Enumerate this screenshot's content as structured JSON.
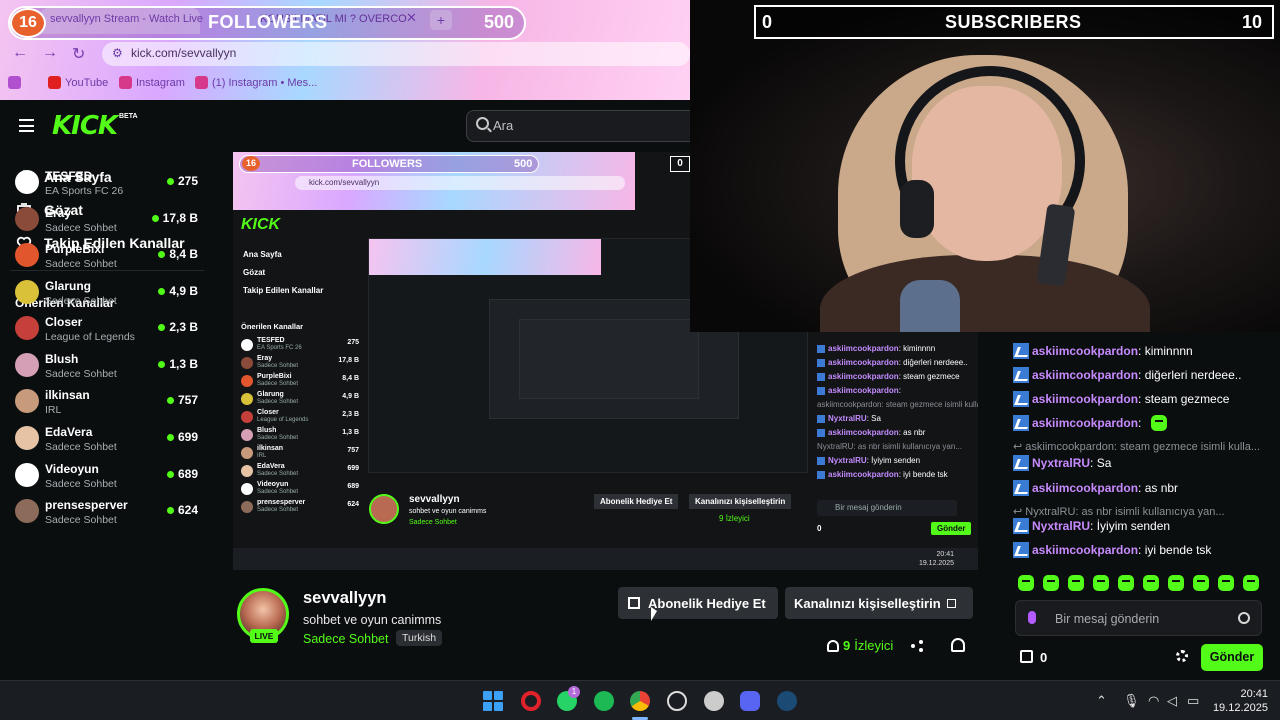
{
  "overlay": {
    "followers": {
      "current": "16",
      "label": "FOLLOWERS",
      "goal": "500"
    },
    "subscribers": {
      "current": "0",
      "label": "SUBSCRIBERS",
      "goal": "10"
    }
  },
  "browser": {
    "tab_active": "sevvallyyn Stream - Watch Live",
    "tab_second": "KONSILMATIL MI ? OVERCO",
    "tab_close": "✕",
    "tab_new": "+",
    "url": "kick.com/sevvallyyn",
    "bookmarks": [
      "YouTube",
      "Instagram",
      "(1) Instagram • Mes..."
    ]
  },
  "header": {
    "logo": "KICK",
    "beta": "BETA",
    "search_placeholder": "Ara"
  },
  "sidebar": {
    "nav": [
      {
        "label": "Ana Sayfa",
        "icon": "home-icon"
      },
      {
        "label": "Gözat",
        "icon": "browse-icon"
      },
      {
        "label": "Takip Edilen Kanallar",
        "icon": "heart-icon"
      }
    ],
    "recommended_title": "Önerilen Kanallar",
    "channels": [
      {
        "name": "TESFED",
        "category": "EA Sports FC 26",
        "viewers": "275",
        "color": "#ffffff"
      },
      {
        "name": "Eray",
        "category": "Sadece Sohbet",
        "viewers": "17,8 B",
        "color": "#8a4b3a"
      },
      {
        "name": "PurpleBixi",
        "category": "Sadece Sohbet",
        "viewers": "8,4 B",
        "color": "#e2562d"
      },
      {
        "name": "Glarung",
        "category": "Sadece Sohbet",
        "viewers": "4,9 B",
        "color": "#d9c23a"
      },
      {
        "name": "Closer",
        "category": "League of Legends",
        "viewers": "2,3 B",
        "color": "#c5403a"
      },
      {
        "name": "Blush",
        "category": "Sadece Sohbet",
        "viewers": "1,3 B",
        "color": "#d5a0b6"
      },
      {
        "name": "ilkinsan",
        "category": "IRL",
        "viewers": "757",
        "color": "#c79a7c"
      },
      {
        "name": "EdaVera",
        "category": "Sadece Sohbet",
        "viewers": "699",
        "color": "#e6c3a5"
      },
      {
        "name": "Videoyun",
        "category": "Sadece Sohbet",
        "viewers": "689",
        "color": "#ffffff"
      },
      {
        "name": "prensesperver",
        "category": "Sadece Sohbet",
        "viewers": "624",
        "color": "#8d6b5a"
      }
    ]
  },
  "preview": {
    "nested_rows": [
      "TESFED",
      "Eray",
      "PurpleBixi",
      "Glarung",
      "Closer",
      "Blush",
      "ilkinsan",
      "EdaVera",
      "Videoyun",
      "prensesperver"
    ],
    "nested_counts": [
      "275",
      "17,8 B",
      "8,4 B",
      "4,9 B",
      "2,3 B",
      "1,3 B",
      "757",
      "699",
      "689",
      "624"
    ],
    "nested_zero": "0"
  },
  "chat": {
    "messages": [
      {
        "type": "msg",
        "user": "askiimcookpardon",
        "text": "kiminnnn"
      },
      {
        "type": "msg",
        "user": "askiimcookpardon",
        "text": "diğerleri nerdeee.."
      },
      {
        "type": "msg",
        "user": "askiimcookpardon",
        "text": "steam gezmece"
      },
      {
        "type": "msg",
        "user": "askiimcookpardon",
        "text": ""
      },
      {
        "type": "reply",
        "text": "askiimcookpardon: steam gezmece isimli kulla..."
      },
      {
        "type": "msg",
        "user": "NyxtralRU",
        "text": "Sa"
      },
      {
        "type": "msg",
        "user": "askiimcookpardon",
        "text": "as nbr"
      },
      {
        "type": "reply",
        "text": "NyxtralRU: as nbr isimli kullanıcıya yan..."
      },
      {
        "type": "msg",
        "user": "NyxtralRU",
        "text": "İyiyim senden"
      },
      {
        "type": "msg",
        "user": "askiimcookpardon",
        "text": "iyi bende tsk"
      }
    ],
    "input_placeholder": "Bir mesaj gönderin",
    "points": "0",
    "send_label": "Gönder"
  },
  "channel": {
    "name": "sevvallyyn",
    "title": "sohbet ve oyun canimms",
    "category": "Sadece Sohbet",
    "tag": "Turkish",
    "live": "LIVE",
    "gift_label": "Abonelik Hediye Et",
    "customize_label": "Kanalınızı kişiselleştirin",
    "viewers": "9",
    "viewers_label": "İzleyici"
  },
  "taskbar": {
    "time": "20:41",
    "date": "19.12.2025",
    "whatsapp_badge": "1"
  },
  "colors": {
    "kick_green": "#53fc18",
    "chat_user": "#c88bff",
    "overlay_orange": "#e8612d"
  }
}
